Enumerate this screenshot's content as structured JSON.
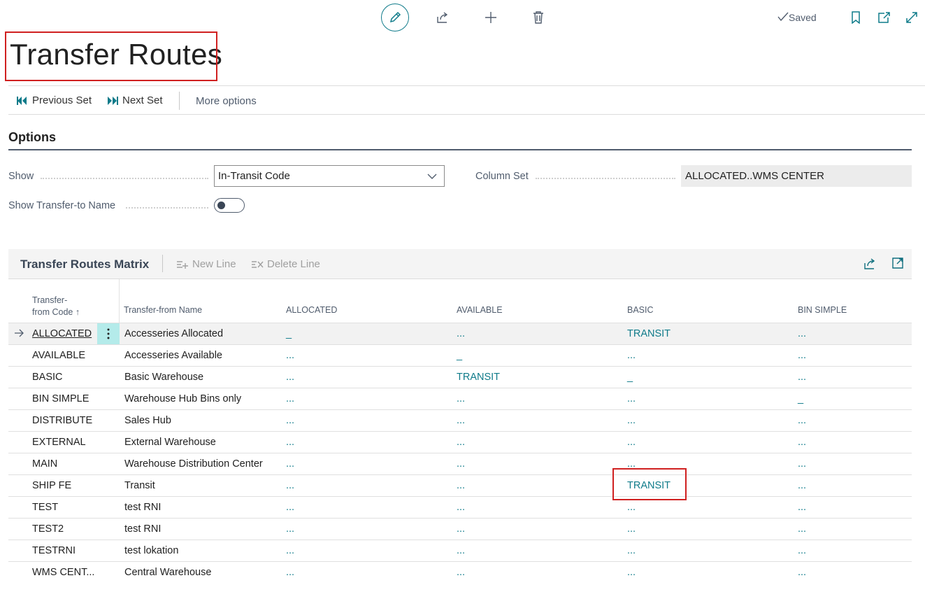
{
  "header": {
    "saved_label": "Saved",
    "icons": [
      "edit-icon",
      "share-icon",
      "add-icon",
      "delete-icon",
      "check-icon",
      "bookmark-icon",
      "open-new-window-icon",
      "expand-icon"
    ]
  },
  "page": {
    "title": "Transfer Routes"
  },
  "actions": {
    "previous_set": "Previous Set",
    "next_set": "Next Set",
    "more_options": "More options"
  },
  "options": {
    "heading": "Options",
    "show_label": "Show",
    "show_value": "In-Transit Code",
    "column_set_label": "Column Set",
    "column_set_value": "ALLOCATED..WMS CENTER",
    "show_transfer_to_name_label": "Show Transfer-to Name",
    "show_transfer_to_name_on": false
  },
  "matrix": {
    "title": "Transfer Routes Matrix",
    "new_line": "New Line",
    "delete_line": "Delete Line",
    "headers": {
      "code_line1": "Transfer-",
      "code_line2": "from Code ↑",
      "name": "Transfer-from Name",
      "columns": [
        "ALLOCATED",
        "AVAILABLE",
        "BASIC",
        "BIN SIMPLE"
      ]
    },
    "rows": [
      {
        "code": "ALLOCATED",
        "name": "Accesseries Allocated",
        "values": [
          "_",
          "...",
          "TRANSIT",
          "..."
        ]
      },
      {
        "code": "AVAILABLE",
        "name": "Accesseries Available",
        "values": [
          "...",
          "_",
          "...",
          "..."
        ]
      },
      {
        "code": "BASIC",
        "name": "Basic Warehouse",
        "values": [
          "...",
          "TRANSIT",
          "_",
          "..."
        ]
      },
      {
        "code": "BIN SIMPLE",
        "name": "Warehouse Hub Bins only",
        "values": [
          "...",
          "...",
          "...",
          "_"
        ]
      },
      {
        "code": "DISTRIBUTE",
        "name": "Sales Hub",
        "values": [
          "...",
          "...",
          "...",
          "..."
        ]
      },
      {
        "code": "EXTERNAL",
        "name": "External Warehouse",
        "values": [
          "...",
          "...",
          "...",
          "..."
        ]
      },
      {
        "code": "MAIN",
        "name": "Warehouse Distribution Center",
        "values": [
          "...",
          "...",
          "...",
          "..."
        ]
      },
      {
        "code": "SHIP FE",
        "name": "Transit",
        "values": [
          "...",
          "...",
          "TRANSIT",
          "..."
        ]
      },
      {
        "code": "TEST",
        "name": "test RNI",
        "values": [
          "...",
          "...",
          "...",
          "..."
        ]
      },
      {
        "code": "TEST2",
        "name": "test RNI",
        "values": [
          "...",
          "...",
          "...",
          "..."
        ]
      },
      {
        "code": "TESTRNI",
        "name": "test lokation",
        "values": [
          "...",
          "...",
          "...",
          "..."
        ]
      },
      {
        "code": "WMS CENT...",
        "name": "Central Warehouse",
        "values": [
          "...",
          "...",
          "...",
          "..."
        ]
      }
    ]
  },
  "colors": {
    "accent": "#0f7b8a",
    "highlight_border": "#d02020",
    "selected_menu": "#b4ebea"
  }
}
